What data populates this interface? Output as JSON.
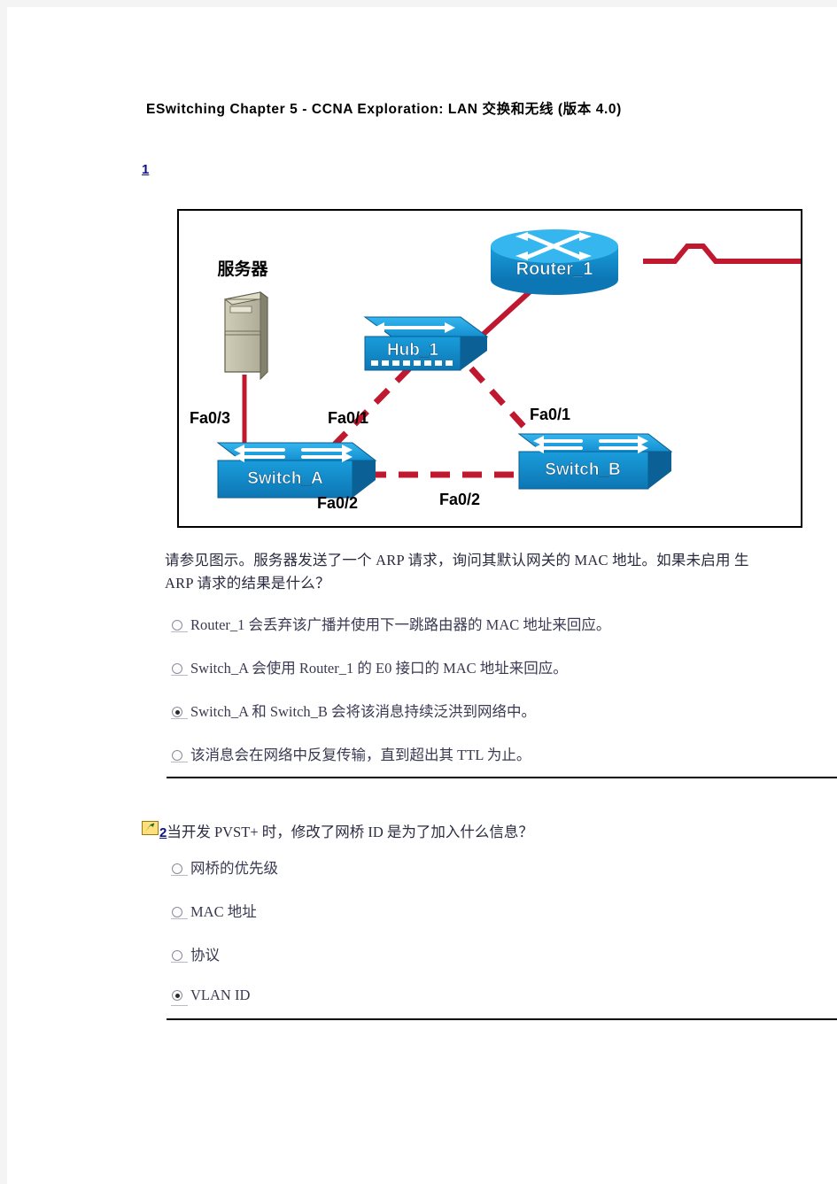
{
  "document": {
    "title": "ESwitching Chapter 5 - CCNA Exploration: LAN 交换和无线 (版本 4.0)"
  },
  "questions": [
    {
      "number": "1",
      "stem_line1": "请参见图示。服务器发送了一个 ARP 请求，询问其默认网关的 MAC 地址。如果未启用 生",
      "stem_line2": "ARP 请求的结果是什么？",
      "options": [
        {
          "label": "Router_1 会丢弃该广播并使用下一跳路由器的 MAC 地址来回应。",
          "selected": false
        },
        {
          "label": "Switch_A 会使用 Router_1 的 E0 接口的 MAC 地址来回应。",
          "selected": false
        },
        {
          "label": "Switch_A 和 Switch_B 会将该消息持续泛洪到网络中。",
          "selected": true
        },
        {
          "label": "该消息会在网络中反复传输，直到超出其 TTL 为止。",
          "selected": false
        }
      ]
    },
    {
      "number": "2",
      "stem": "当开发 PVST+ 时，修改了网桥 ID 是为了加入什么信息？",
      "options": [
        {
          "label": "网桥的优先级",
          "selected": false
        },
        {
          "label": "MAC 地址",
          "selected": false
        },
        {
          "label": "协议",
          "selected": false
        },
        {
          "label": "VLAN ID",
          "selected": true
        }
      ]
    }
  ],
  "diagram": {
    "nodes": [
      {
        "name": "服务器",
        "type": "server"
      },
      {
        "name": "Router_1",
        "type": "router"
      },
      {
        "name": "Hub_1",
        "type": "hub"
      },
      {
        "name": "Switch_A",
        "type": "switch"
      },
      {
        "name": "Switch_B",
        "type": "switch"
      }
    ],
    "port_labels": [
      {
        "text": "Fa0/3"
      },
      {
        "text": "Fa0/1"
      },
      {
        "text": "Fa0/1"
      },
      {
        "text": "Fa0/2"
      },
      {
        "text": "Fa0/2"
      }
    ],
    "colors": {
      "link": "#c0182f",
      "device_blue": "#1a9ddb",
      "device_blue_dark": "#0f6fa8",
      "server_beige": "#b5b39a",
      "border": "#000000"
    }
  }
}
